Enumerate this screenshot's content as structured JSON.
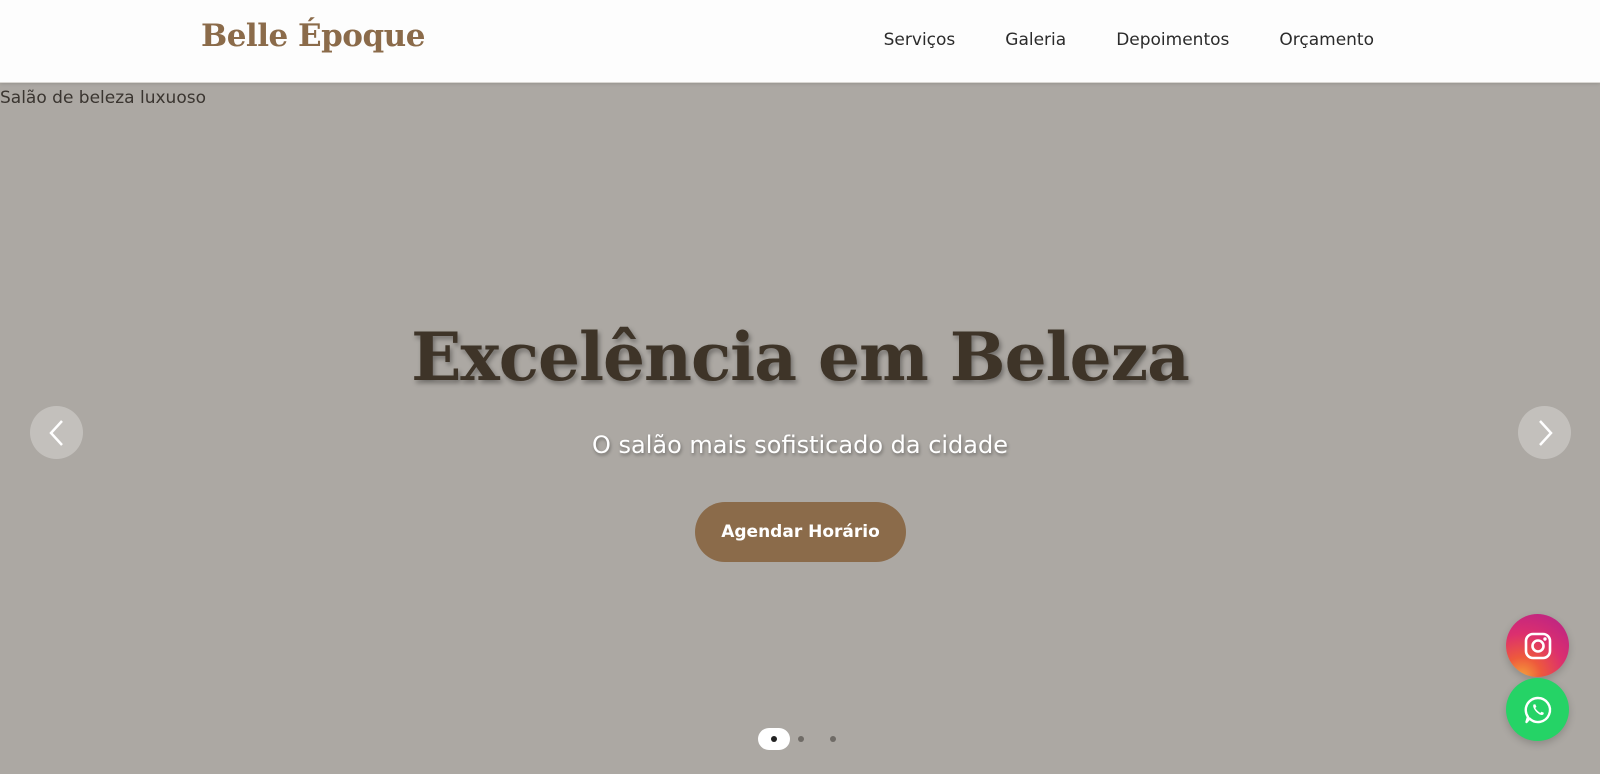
{
  "header": {
    "logo": "Belle Époque",
    "nav": [
      "Serviços",
      "Galeria",
      "Depoimentos",
      "Orçamento"
    ]
  },
  "hero": {
    "image_alt": "Salão de beleza luxuoso",
    "title": "Excelência em Beleza",
    "subtitle": "O salão mais sofisticado da cidade",
    "cta_label": "Agendar Horário",
    "slides_total": 3,
    "active_slide": 1
  },
  "floating": {
    "instagram_icon": "instagram-icon",
    "whatsapp_icon": "whatsapp-icon"
  },
  "colors": {
    "brand": "#8b6b4a",
    "hero_bg": "#aca8a3",
    "whatsapp": "#25d366"
  }
}
